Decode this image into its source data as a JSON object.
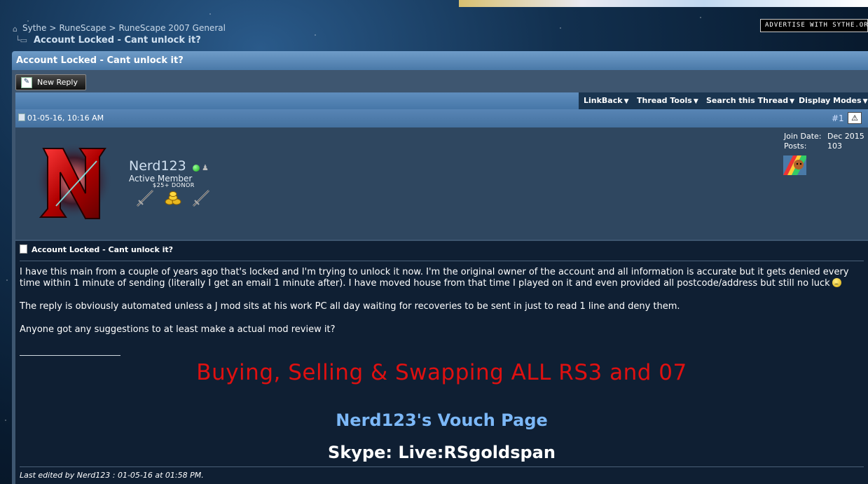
{
  "breadcrumb": {
    "items": [
      "Sythe",
      "RuneScape",
      "RuneScape 2007 General"
    ],
    "separator": ">",
    "current": "Account Locked - Cant unlock it?"
  },
  "advertise_label": "ADVERTISE WITH SYTHE.ORG",
  "thread_title": "Account Locked - Cant unlock it?",
  "new_reply_label": "New Reply",
  "toolbar": {
    "linkback": "LinkBack",
    "thread_tools": "Thread Tools",
    "search_thread": "Search this Thread",
    "display_modes": "Display Modes"
  },
  "post": {
    "date": "01-05-16, 10:16 AM",
    "number": "#1",
    "username": "Nerd123",
    "user_title": "Active Member",
    "donor_label": "$25+ DONOR",
    "join_date_label": "Join Date:",
    "join_date": "Dec 2015",
    "posts_label": "Posts:",
    "posts": "103",
    "title": "Account Locked - Cant unlock it?",
    "paragraph1": "I have this main from a couple of years ago that's locked and I'm trying to unlock it now. I'm the original owner of the account and all information is accurate but it gets denied every time within 1 minute of sending (literally I get an email 1 minute after). I have moved house from that time I played on it and even provided all postcode/address but still no luck",
    "paragraph2": "The reply is obviously automated unless a J mod sits at his work PC all day waiting for recoveries to be sent in just to read 1 line and deny them.",
    "paragraph3": "Anyone got any suggestions to at least make a actual mod review it?",
    "sig_buying": "Buying, Selling & Swapping ALL RS3 and 07",
    "sig_vouch": "Nerd123's Vouch Page",
    "sig_skype": "Skype: Live:RSgoldspan",
    "edited": "Last edited by Nerd123 : 01-05-16 at 01:58 PM."
  },
  "colors": {
    "title_bar": "#5a88b8",
    "sig_red": "#e01010",
    "sig_blue": "#7cb8f8",
    "post_bg": "#0f1f33"
  }
}
